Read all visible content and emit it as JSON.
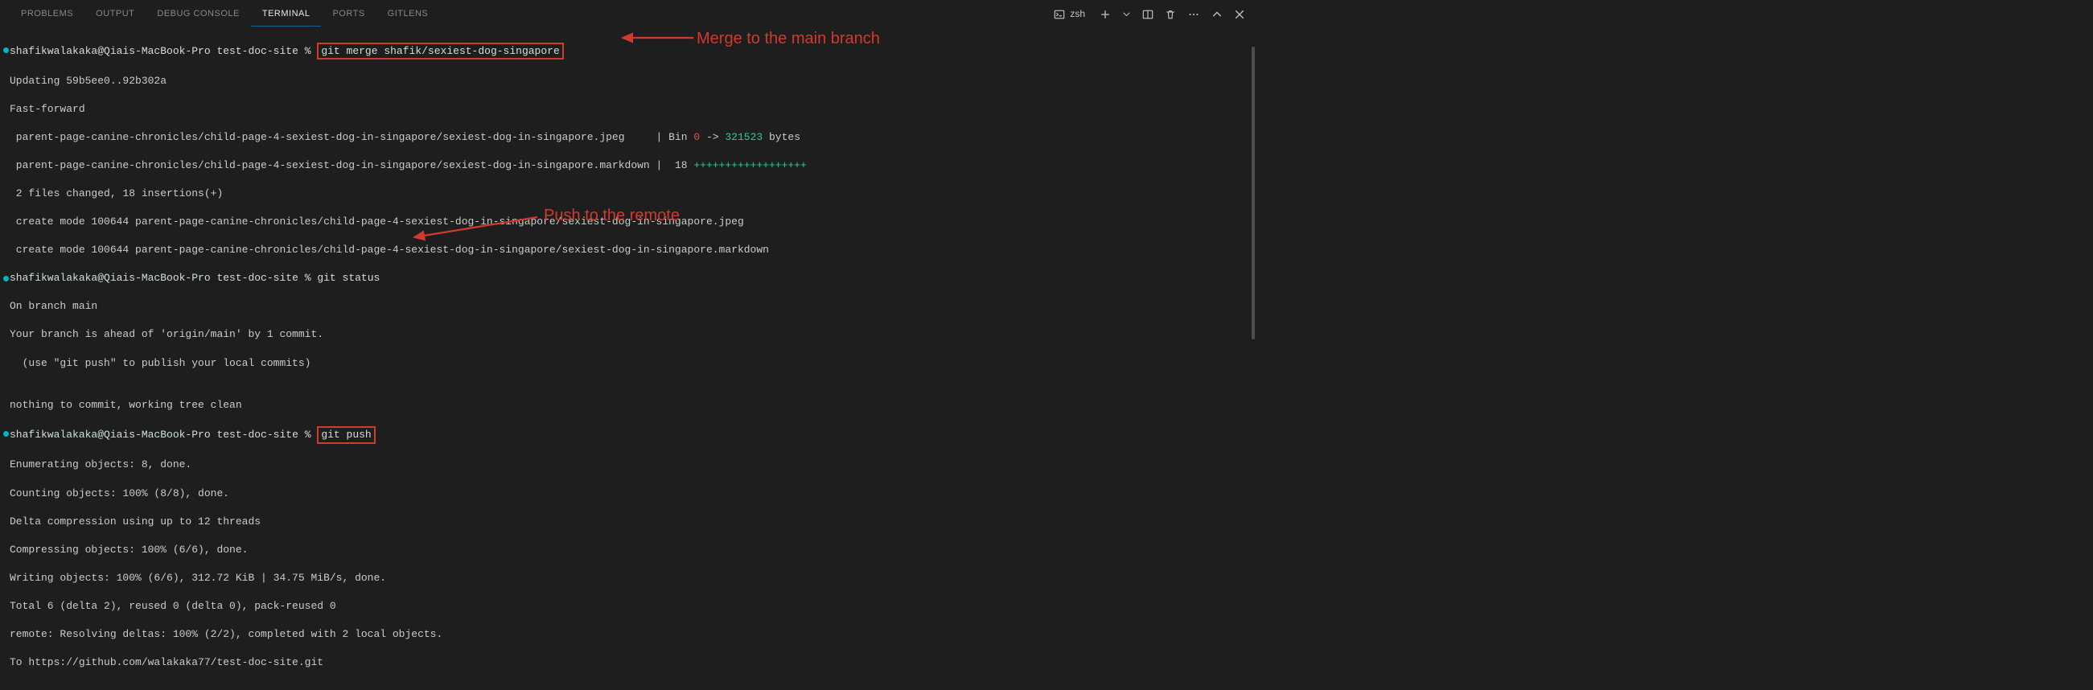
{
  "tabs": {
    "problems": "PROBLEMS",
    "output": "OUTPUT",
    "debug": "DEBUG CONSOLE",
    "terminal": "TERMINAL",
    "ports": "PORTS",
    "gitlens": "GITLENS"
  },
  "toolbar": {
    "shell": "zsh"
  },
  "prompt": {
    "userhost": "shafikwalakaka@Qiais-MacBook-Pro",
    "dir": "test-doc-site",
    "sigil": "%"
  },
  "cmd": {
    "merge": "git merge shafik/sexiest-dog-singapore",
    "status": "git status",
    "push": "git push"
  },
  "out": {
    "updating": "Updating 59b5ee0..92b302a",
    "ff": "Fast-forward",
    "file1_path": " parent-page-canine-chronicles/child-page-4-sexiest-dog-in-singapore/sexiest-dog-in-singapore.jpeg     | Bin ",
    "file1_zero": "0",
    "file1_arrow": " -> ",
    "file1_size": "321523",
    "file1_bytes": " bytes",
    "file2_path": " parent-page-canine-chronicles/child-page-4-sexiest-dog-in-singapore/sexiest-dog-in-singapore.markdown |  18 ",
    "file2_pluses": "++++++++++++++++++",
    "summary": " 2 files changed, 18 insertions(+)",
    "create1": " create mode 100644 parent-page-canine-chronicles/child-page-4-sexiest-dog-in-singapore/sexiest-dog-in-singapore.jpeg",
    "create2": " create mode 100644 parent-page-canine-chronicles/child-page-4-sexiest-dog-in-singapore/sexiest-dog-in-singapore.markdown",
    "onbranch": "On branch main",
    "ahead": "Your branch is ahead of 'origin/main' by 1 commit.",
    "usepush": "  (use \"git push\" to publish your local commits)",
    "blank": "",
    "nothing": "nothing to commit, working tree clean",
    "enum": "Enumerating objects: 8, done.",
    "counting": "Counting objects: 100% (8/8), done.",
    "delta": "Delta compression using up to 12 threads",
    "compress": "Compressing objects: 100% (6/6), done.",
    "writing": "Writing objects: 100% (6/6), 312.72 KiB | 34.75 MiB/s, done.",
    "total": "Total 6 (delta 2), reused 0 (delta 0), pack-reused 0",
    "resolve": "remote: Resolving deltas: 100% (2/2), completed with 2 local objects.",
    "to": "To https://github.com/walakaka77/test-doc-site.git"
  },
  "annot": {
    "merge": "Merge to the main branch",
    "push": "Push to the remote"
  }
}
